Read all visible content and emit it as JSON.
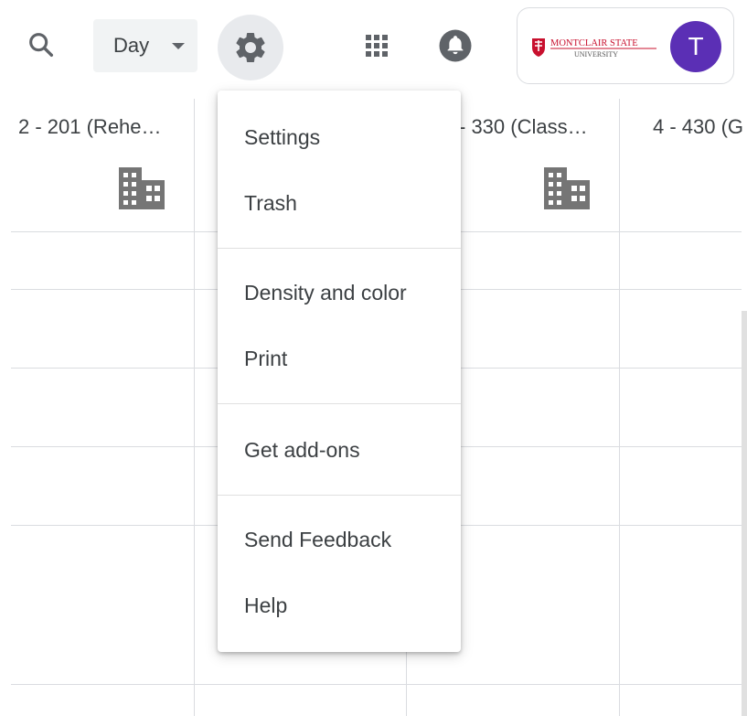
{
  "toolbar": {
    "search_icon": "search-icon",
    "view_select": {
      "value": "Day",
      "icon": "chevron-down-icon"
    },
    "settings_icon": "gear-icon",
    "apps_icon": "apps-grid-icon",
    "notifications_icon": "bell-icon"
  },
  "account": {
    "logo_text_top": "MONTCLAIR STATE",
    "logo_text_bottom": "UNIVERSITY",
    "avatar_initial": "T",
    "avatar_color": "#5b2fb5",
    "logo_color": "#c8102e"
  },
  "calendar": {
    "columns": [
      {
        "label": "2 - 201 (Rehe…",
        "icon": "building-icon"
      },
      {
        "label": "- 330 (Class…",
        "icon": "building-icon"
      },
      {
        "label": "4 - 430 (G"
      }
    ]
  },
  "settings_menu": {
    "groups": [
      [
        "Settings",
        "Trash"
      ],
      [
        "Density and color",
        "Print"
      ],
      [
        "Get add-ons"
      ],
      [
        "Send Feedback",
        "Help"
      ]
    ],
    "items": {
      "settings": "Settings",
      "trash": "Trash",
      "density_color": "Density and color",
      "print": "Print",
      "get_addons": "Get add-ons",
      "send_feedback": "Send Feedback",
      "help": "Help"
    }
  }
}
